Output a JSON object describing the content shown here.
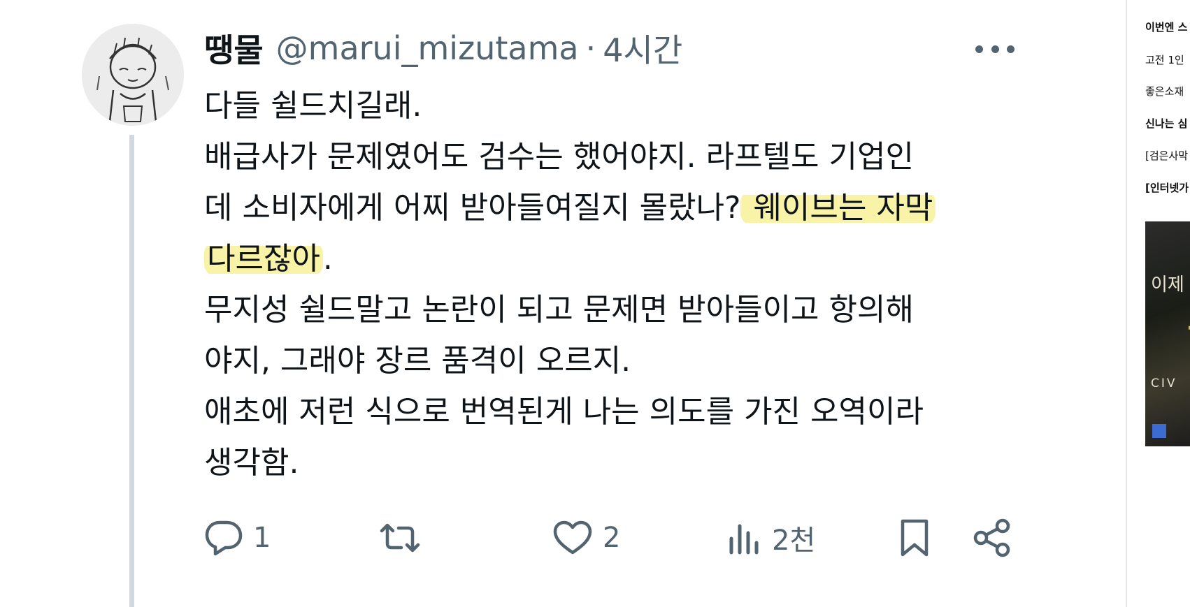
{
  "tweet": {
    "display_name": "땡물",
    "handle": "@marui_mizutama",
    "separator": "·",
    "time": "4시간",
    "body_lines": [
      {
        "text": "다들 쉴드치길래.",
        "highlight": ""
      },
      {
        "text": "배급사가 문제였어도 검수는 했어야지. 라프텔도 기업인",
        "highlight": ""
      },
      {
        "text": "데 소비자에게 어찌 받아들여질지 몰랐나?",
        "highlight": " 웨이브는 자막"
      },
      {
        "text": "",
        "highlight": "다르잖아",
        "after": "."
      },
      {
        "text": "무지성 쉴드말고 논란이 되고 문제면 받아들이고 항의해",
        "highlight": ""
      },
      {
        "text": "야지, 그래야 장르 품격이 오르지.",
        "highlight": ""
      },
      {
        "text": "애초에 저런 식으로 번역된게 나는 의도를 가진 오역이라",
        "highlight": ""
      },
      {
        "text": "생각함.",
        "highlight": ""
      }
    ],
    "actions": {
      "reply_count": "1",
      "retweet_count": "",
      "like_count": "2",
      "views_count": "2천"
    },
    "highlight_color": "#f8f3a6",
    "icons": [
      "reply-icon",
      "retweet-icon",
      "like-icon",
      "views-icon",
      "bookmark-icon",
      "share-icon",
      "more-icon"
    ]
  },
  "sidebar": {
    "items": [
      {
        "label": "이번엔 스",
        "bold": true
      },
      {
        "label": "고전 1인",
        "bold": false
      },
      {
        "label": "좋은소재",
        "bold": false
      },
      {
        "label": "신나는 심",
        "bold": true
      },
      {
        "label": "[검은사막",
        "bold": false
      },
      {
        "label": "[인터넷가",
        "bold": true
      }
    ],
    "ad_text_1": "이제",
    "ad_text_2": "한",
    "ad_text_3": "CIV"
  }
}
